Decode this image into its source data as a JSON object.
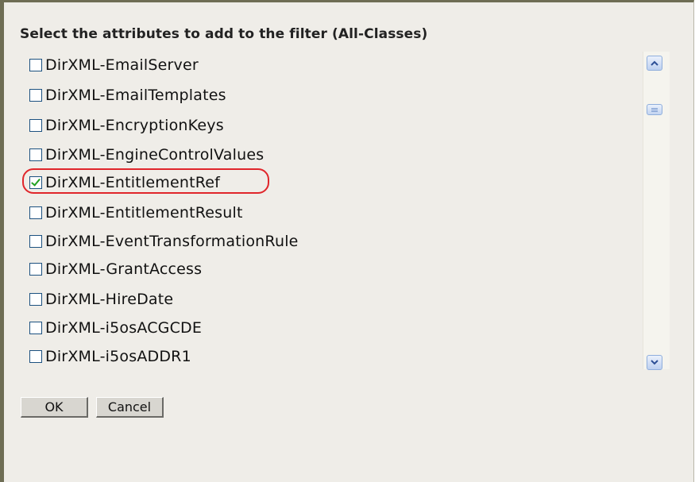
{
  "dialog": {
    "heading": "Select the attributes to add to the filter (All-Classes)"
  },
  "attributes": [
    {
      "label": "DirXML-EmailServer",
      "checked": false
    },
    {
      "label": "DirXML-EmailTemplates",
      "checked": false
    },
    {
      "label": "DirXML-EncryptionKeys",
      "checked": false
    },
    {
      "label": "DirXML-EngineControlValues",
      "checked": false
    },
    {
      "label": "DirXML-EntitlementRef",
      "checked": true
    },
    {
      "label": "DirXML-EntitlementResult",
      "checked": false
    },
    {
      "label": "DirXML-EventTransformationRule",
      "checked": false
    },
    {
      "label": "DirXML-GrantAccess",
      "checked": false
    },
    {
      "label": "DirXML-HireDate",
      "checked": false
    },
    {
      "label": "DirXML-i5osACGCDE",
      "checked": false
    },
    {
      "label": "DirXML-i5osADDR1",
      "checked": false
    }
  ],
  "buttons": {
    "ok": "OK",
    "cancel": "Cancel"
  },
  "icons": {
    "scroll_up": "chevron-up-icon",
    "scroll_down": "chevron-down-icon",
    "checkmark": "checkmark-icon"
  },
  "colors": {
    "highlight": "#e0262b",
    "check": "#21a121",
    "border": "#6e6d54"
  }
}
